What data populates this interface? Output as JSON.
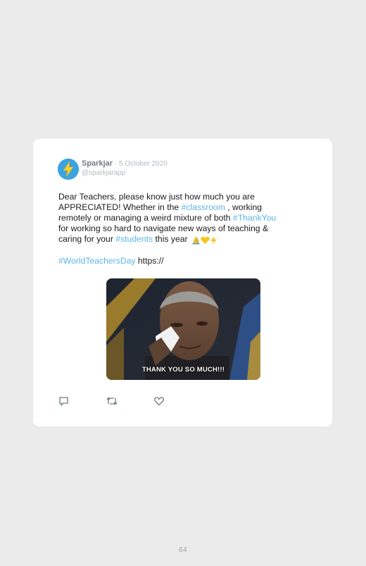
{
  "tweet": {
    "author_name": "Sparkjar",
    "separator": " · ",
    "date": "5 October 2020",
    "handle": "@sparkjarapp",
    "avatar_icon": "lightning-bolt-icon",
    "avatar_color": "#3ba3df",
    "text": {
      "line1": "Dear Teachers, please know just how much you are",
      "line2_a": "APPRECIATED! Whether in the ",
      "line2_tag": "#classroom",
      "line2_b": " , working",
      "line3_a": "remotely or managing a weird mixture of both ",
      "line3_tag": "#ThankYou",
      "line4": "for working so hard to navigate new ways of teaching &",
      "line5_a": "caring for your ",
      "line5_tag": "#students",
      "line5_b": " this year ",
      "emojis": [
        "folded-hands-emoji",
        "yellow-heart-emoji",
        "high-voltage-emoji"
      ],
      "line7_tag": "#WorldTeachersDay",
      "line7_b": " https://"
    },
    "hashtag_color": "#5bb7e6",
    "media": {
      "caption": "THANK YOU SO MUCH!!!"
    },
    "actions": [
      "reply-icon",
      "retweet-icon",
      "like-icon"
    ]
  },
  "page_number": "64"
}
